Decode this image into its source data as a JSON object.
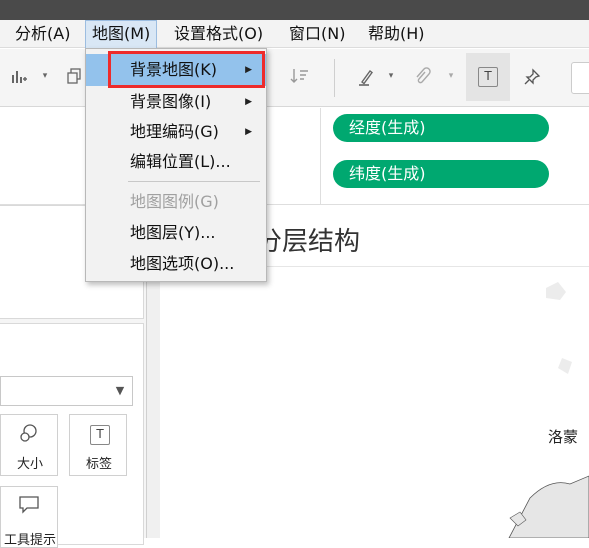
{
  "menubar": {
    "items": [
      "分析(A)",
      "地图(M)",
      "设置格式(O)",
      "窗口(N)",
      "帮助(H)"
    ],
    "active": "地图(M)"
  },
  "dropdown": {
    "items": [
      {
        "label": "背景地图(K)",
        "submenu": true,
        "highlighted": true
      },
      {
        "label": "背景图像(I)",
        "submenu": true
      },
      {
        "label": "地理编码(G)",
        "submenu": true
      },
      {
        "label": "编辑位置(L)..."
      },
      {
        "label": "地图图例(G)",
        "disabled": true
      },
      {
        "label": "地图层(Y)..."
      },
      {
        "label": "地图选项(O)..."
      }
    ]
  },
  "toolbar": {
    "icons": [
      "add-chart-icon",
      "dropdown-arrow-icon",
      "duplicate-sheet-icon",
      "sort-icon",
      "highlight-pen-icon",
      "paperclip-icon",
      "text-label-icon",
      "pin-icon"
    ],
    "label_glyph": "T"
  },
  "shelves": {
    "columns_pill": "经度(生成)",
    "rows_pill": "纬度(生成)"
  },
  "view": {
    "title": "分层结构",
    "map_label": "洛蒙"
  },
  "marks": {
    "size_label": "大小",
    "label_label": "标签",
    "tooltip_label": "工具提示",
    "label_glyph": "T"
  },
  "colors": {
    "pill": "#00a870",
    "highlight_frame": "#ee2b2b",
    "menu_highlight": "#93c2ec"
  }
}
